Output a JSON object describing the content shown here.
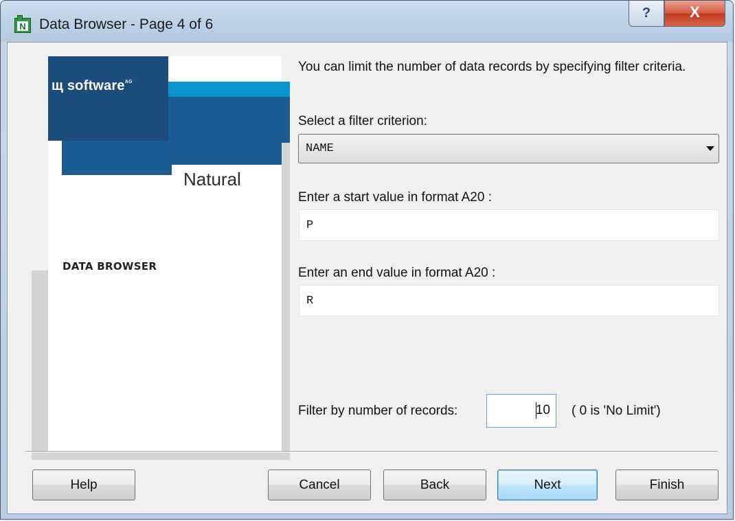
{
  "window": {
    "title": "Data Browser - Page 4 of 6",
    "help_glyph": "?",
    "close_glyph": "X",
    "app_icon_letter": "N"
  },
  "banner": {
    "logo_text": "software",
    "logo_sup": "AG",
    "product": "Natural",
    "module": "DATA BROWSER",
    "colors": {
      "dark_blue": "#1c4c7c",
      "mid_blue": "#1c5c94",
      "cyan": "#0894cc"
    }
  },
  "form": {
    "intro": "You can limit the number of data records by specifying filter criteria.",
    "criterion_label": "Select a filter criterion:",
    "criterion_value": "NAME",
    "start_label": "Enter a start value in format A20 :",
    "start_value": "P",
    "end_label": "Enter an end value in format A20 :",
    "end_value": "R",
    "records_label": "Filter by number of records:",
    "records_value": "10",
    "records_hint": "( 0 is 'No Limit')"
  },
  "buttons": {
    "help": "Help",
    "cancel": "Cancel",
    "back": "Back",
    "next": "Next",
    "finish": "Finish"
  }
}
